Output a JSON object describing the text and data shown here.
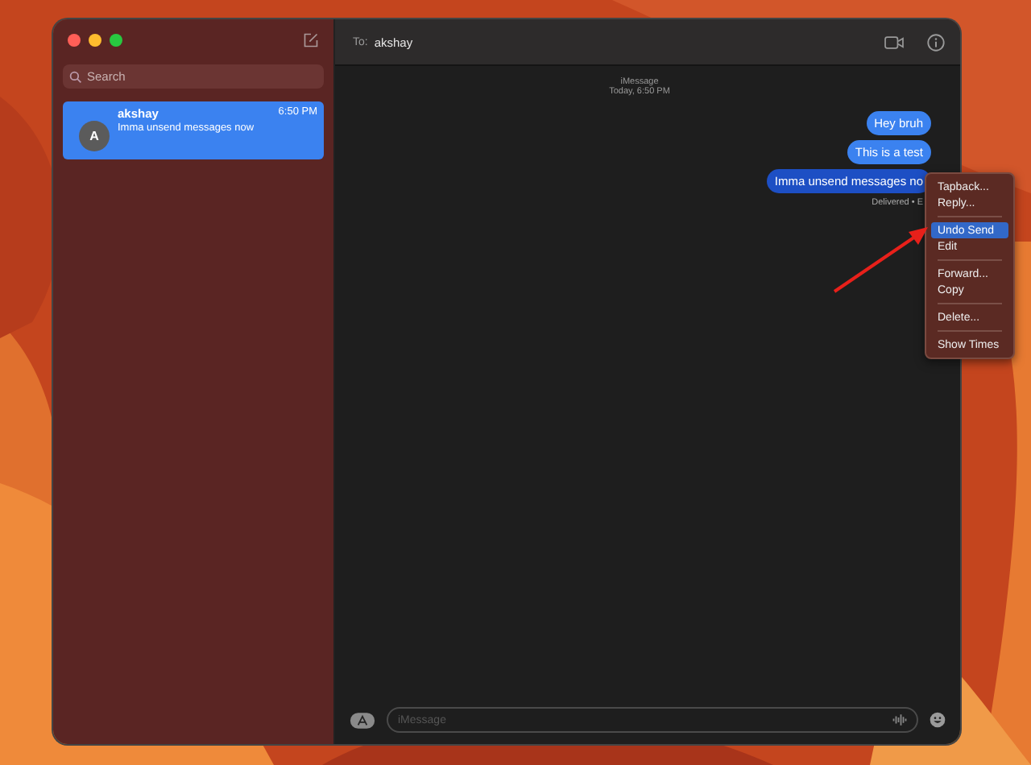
{
  "sidebar": {
    "search": {
      "placeholder": "Search"
    },
    "conversations": [
      {
        "avatar": "A",
        "name": "akshay",
        "time": "6:50 PM",
        "preview": "Imma unsend messages now",
        "selected": true
      }
    ]
  },
  "header": {
    "to_label": "To:",
    "recipient": "akshay"
  },
  "chat": {
    "service": "iMessage",
    "timestamp": "Today, 6:50 PM",
    "messages": [
      {
        "text": "Hey bruh",
        "selected": false
      },
      {
        "text": "This is a test",
        "selected": false
      },
      {
        "text": "Imma unsend messages no",
        "selected": true
      }
    ],
    "status": "Delivered • E"
  },
  "composer": {
    "placeholder": "iMessage"
  },
  "context_menu": {
    "sections": [
      [
        {
          "label": "Tapback...",
          "selected": false
        },
        {
          "label": "Reply...",
          "selected": false
        }
      ],
      [
        {
          "label": "Undo Send",
          "selected": true
        },
        {
          "label": "Edit",
          "selected": false
        }
      ],
      [
        {
          "label": "Forward...",
          "selected": false
        },
        {
          "label": "Copy",
          "selected": false
        }
      ],
      [
        {
          "label": "Delete...",
          "selected": false
        }
      ],
      [
        {
          "label": "Show Times",
          "selected": false
        }
      ]
    ]
  }
}
